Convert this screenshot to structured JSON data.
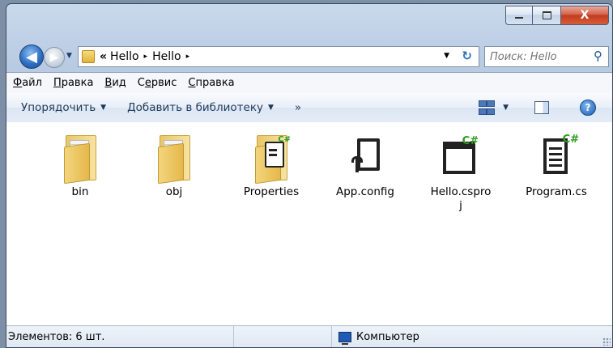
{
  "window": {
    "caption": {
      "minimize": "–",
      "maximize": "□",
      "close": "X"
    }
  },
  "address": {
    "chevron": "«",
    "crumbs": [
      "Hello",
      "Hello"
    ],
    "sep": "▸"
  },
  "search": {
    "placeholder": "Поиск: Hello"
  },
  "menu": {
    "items": [
      {
        "label": "Файл",
        "accel": "Ф",
        "rest": "айл"
      },
      {
        "label": "Правка",
        "accel": "П",
        "rest": "равка"
      },
      {
        "label": "Вид",
        "accel": "В",
        "rest": "ид"
      },
      {
        "label": "Сервис",
        "pre": "С",
        "accel": "е",
        "rest": "рвис"
      },
      {
        "label": "Справка",
        "accel": "С",
        "rest": "правка"
      }
    ]
  },
  "toolbar": {
    "organize": "Упорядочить",
    "add_to_library": "Добавить в библиотеку",
    "more": "»",
    "caret": "▼",
    "help": "?"
  },
  "files": [
    {
      "name": "bin",
      "type": "folder"
    },
    {
      "name": "obj",
      "type": "folder"
    },
    {
      "name": "Properties",
      "type": "folder-cs"
    },
    {
      "name": "App.config",
      "type": "config"
    },
    {
      "name": "Hello.csproj",
      "type": "csproj"
    },
    {
      "name": "Program.cs",
      "type": "cs"
    }
  ],
  "badges": {
    "cs": "C#"
  },
  "status": {
    "count": "Элементов: 6 шт.",
    "location": "Компьютер"
  },
  "icons": {
    "back": "◀",
    "forward": "▶",
    "dropdown": "▼",
    "refresh": "↻",
    "search": "⚲"
  }
}
